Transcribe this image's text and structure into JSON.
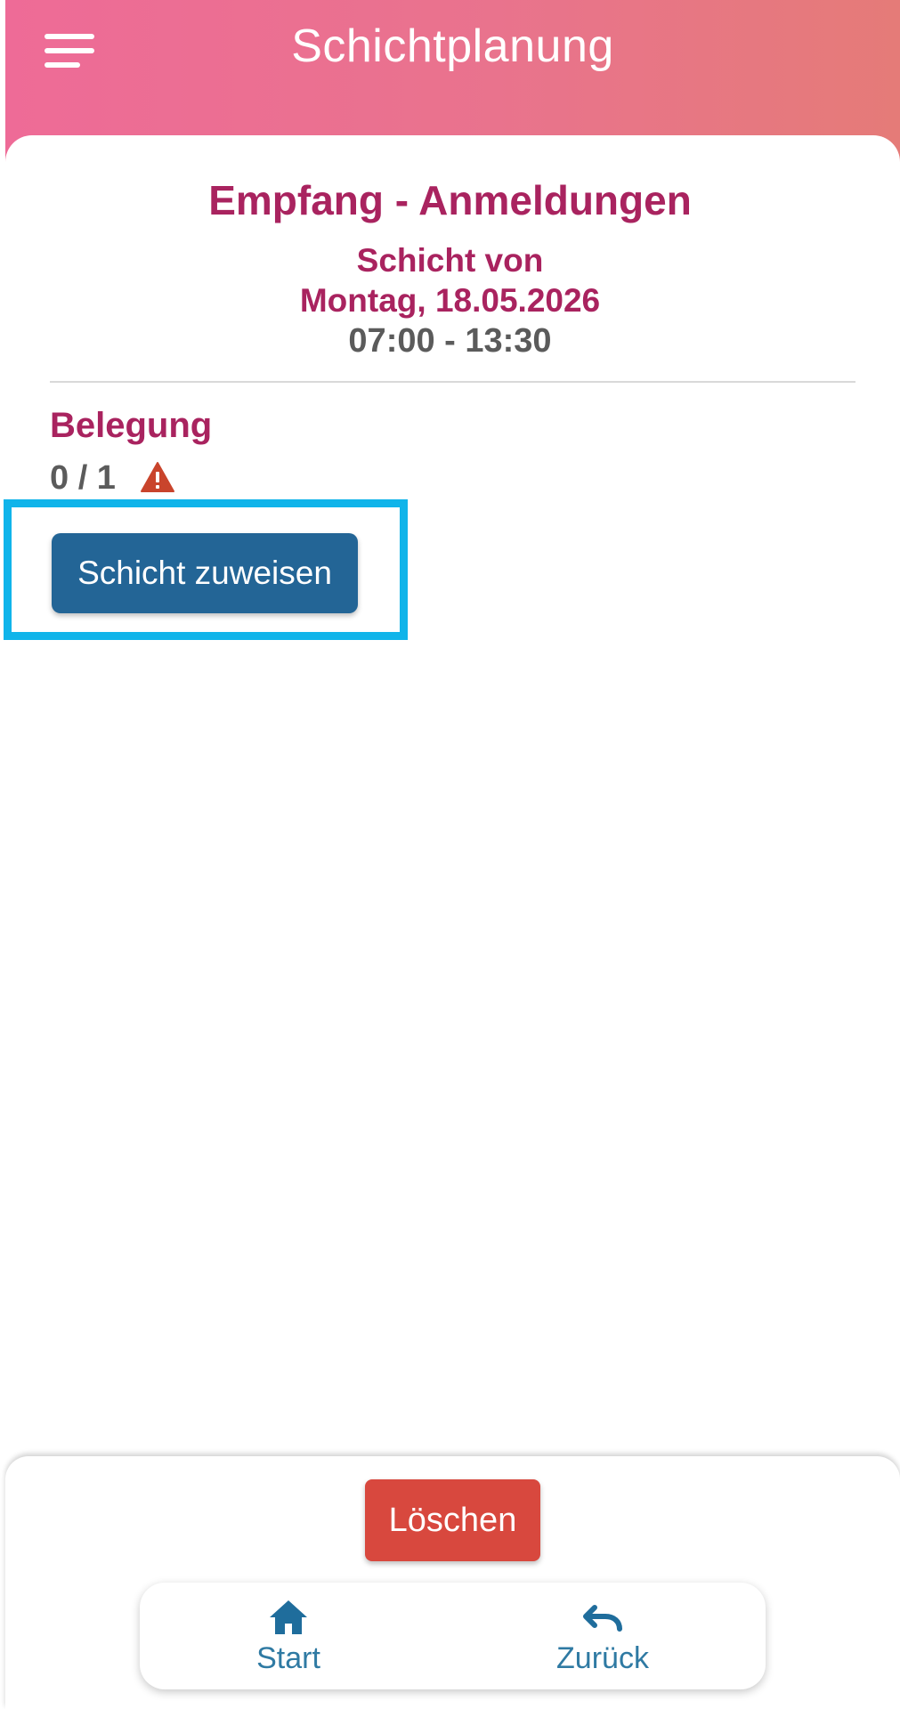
{
  "header": {
    "title": "Schichtplanung",
    "menu_icon": "hamburger-menu-icon",
    "gradient_colors": [
      "#ee6b97",
      "#e57b78"
    ]
  },
  "shift": {
    "title": "Empfang - Anmeldungen",
    "from_label": "Schicht von",
    "date": "Montag, 18.05.2026",
    "time": "07:00 - 13:30"
  },
  "occupancy": {
    "label": "Belegung",
    "value": "0 / 1",
    "warning_icon": "warning-triangle-icon",
    "warning_color": "#c9442c"
  },
  "actions": {
    "assign_label": "Schicht zuweisen",
    "assign_color": "#236596",
    "delete_label": "Löschen",
    "delete_color": "#d8483e",
    "highlight_color": "#10b4ea"
  },
  "nav": {
    "start_label": "Start",
    "start_icon": "home-icon",
    "back_label": "Zurück",
    "back_icon": "undo-arrow-icon",
    "color": "#2a7aa6"
  }
}
